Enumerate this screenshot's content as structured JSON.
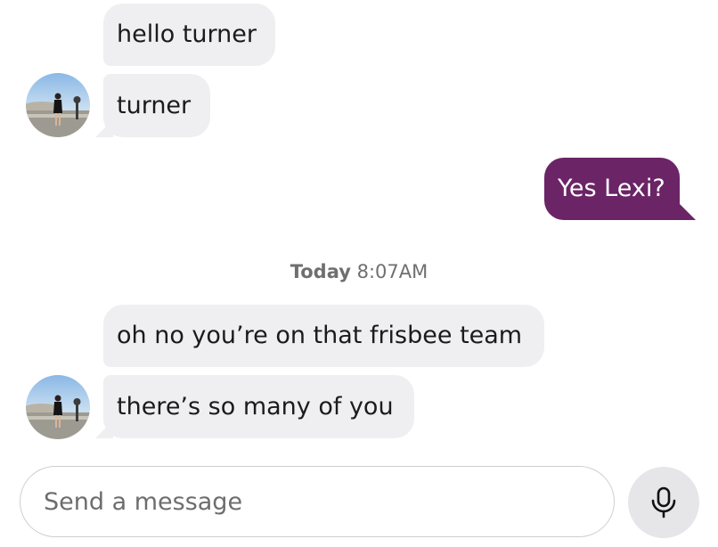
{
  "messages": [
    {
      "id": "b1",
      "direction": "incoming",
      "text": "hello turner"
    },
    {
      "id": "b2",
      "direction": "incoming",
      "text": "turner"
    },
    {
      "id": "b3",
      "direction": "outgoing",
      "text": "Yes Lexi?"
    },
    {
      "id": "b4",
      "direction": "incoming",
      "text": "oh no you’re on that frisbee team"
    },
    {
      "id": "b5",
      "direction": "incoming",
      "text": "there’s so many of you"
    }
  ],
  "timestamp": {
    "day": "Today",
    "time": "8:07AM"
  },
  "composer": {
    "placeholder": "Send a message"
  },
  "icons": {
    "mic": "microphone-icon"
  },
  "colors": {
    "outgoing_bubble": "#6b2466",
    "incoming_bubble": "#efeff1",
    "mic_button": "#e6e6e9"
  }
}
